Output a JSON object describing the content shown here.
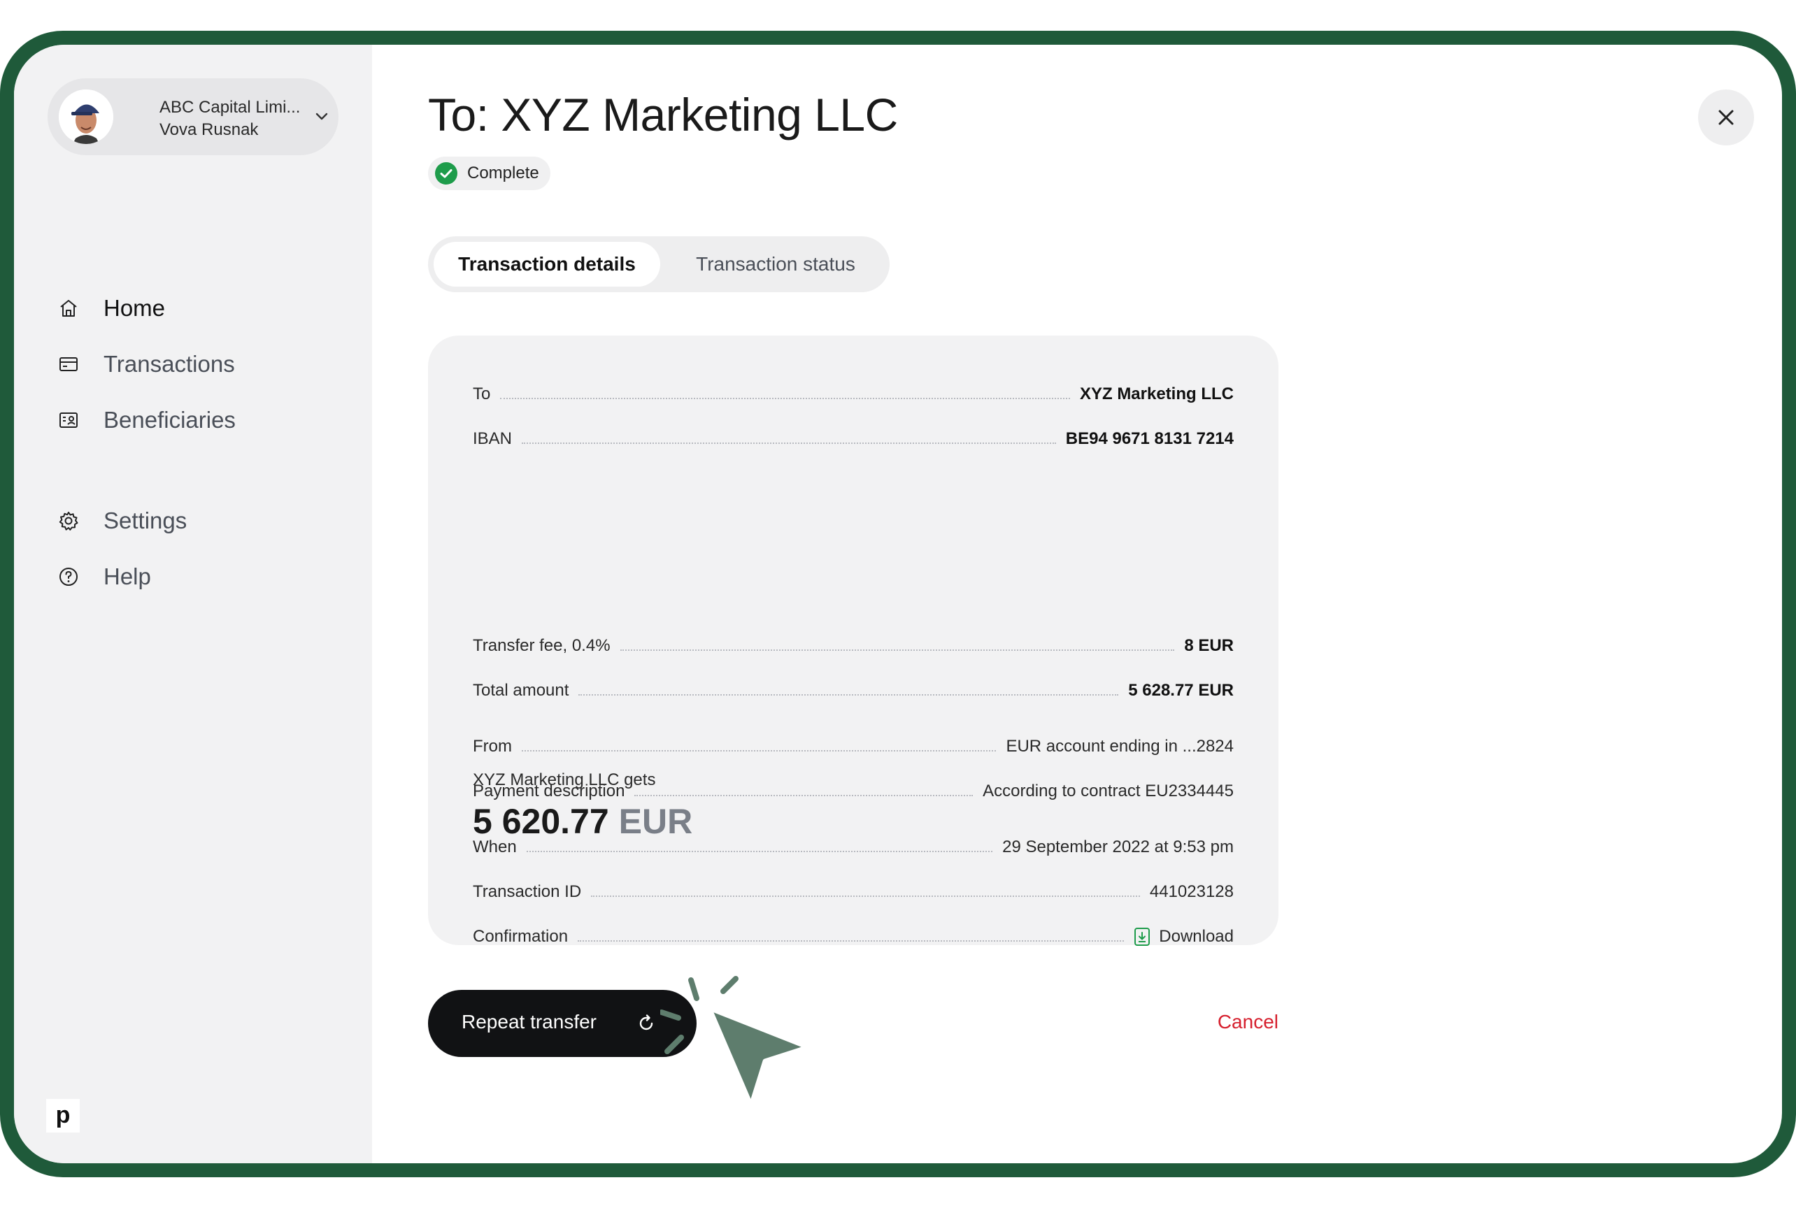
{
  "account": {
    "company": "ABC Capital Limi...",
    "user": "Vova Rusnak"
  },
  "nav": {
    "items": [
      {
        "label": "Home",
        "icon": "home-icon"
      },
      {
        "label": "Transactions",
        "icon": "card-icon"
      },
      {
        "label": "Beneficiaries",
        "icon": "contact-card-icon"
      },
      {
        "label": "Settings",
        "icon": "gear-icon"
      },
      {
        "label": "Help",
        "icon": "help-circle-icon"
      }
    ]
  },
  "brand": {
    "logo_letter": "p"
  },
  "page": {
    "title": "To: XYZ Marketing LLC",
    "status": "Complete"
  },
  "tabs": {
    "details": "Transaction details",
    "status": "Transaction status"
  },
  "details": {
    "to": {
      "label": "To",
      "value": "XYZ Marketing LLC"
    },
    "iban": {
      "label": "IBAN",
      "value": "BE94 9671 8131 7214"
    },
    "gets_label": "XYZ Marketing LLC gets",
    "amount": "5 620.77",
    "amount_currency": "EUR",
    "fee": {
      "label": "Transfer fee, 0.4%",
      "value": "8 EUR"
    },
    "total": {
      "label": "Total amount",
      "value": "5 628.77 EUR"
    },
    "from": {
      "label": "From",
      "value": "EUR account ending in ...2824"
    },
    "description": {
      "label": "Payment description",
      "value": "According to contract EU2334445"
    },
    "when": {
      "label": "When",
      "value": "29 September 2022 at 9:53 pm"
    },
    "transaction_id": {
      "label": "Transaction ID",
      "value": "441023128"
    },
    "confirmation": {
      "label": "Confirmation",
      "value": "Download"
    }
  },
  "actions": {
    "repeat": "Repeat transfer",
    "cancel": "Cancel"
  },
  "colors": {
    "frame": "#1f5a3a",
    "success": "#1e9c4b",
    "danger": "#d6202e",
    "primary_button": "#111214",
    "cursor": "#5e7d6d"
  }
}
